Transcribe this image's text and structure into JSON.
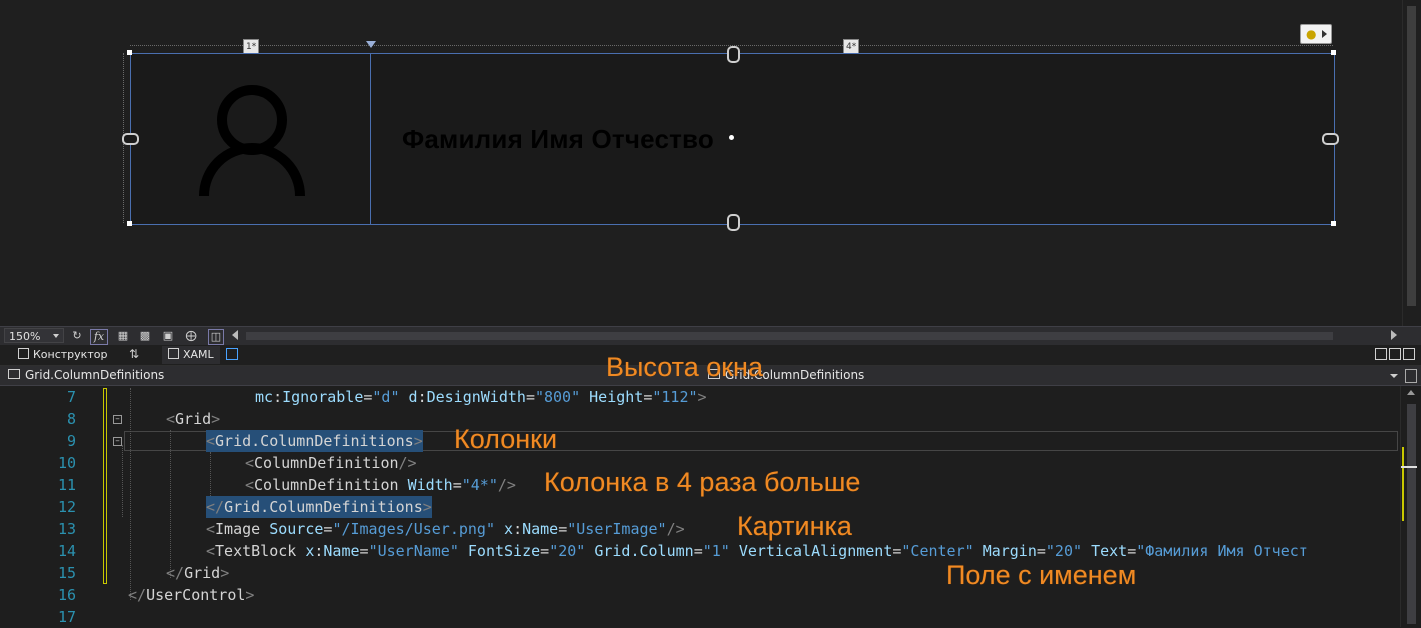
{
  "designer": {
    "column_tags": [
      "1*",
      "4*"
    ],
    "user_name_preview": "Фамилия Имя Отчество",
    "avatar_icon": "user-icon",
    "lightbulb_icon": "lightbulb-icon"
  },
  "toolbar": {
    "zoom": "150%",
    "icons": [
      "refresh-icon",
      "fx-icon",
      "grid-icon",
      "snap-grid-icon",
      "artboard-icon",
      "snap-lines-icon",
      "device-icon"
    ]
  },
  "tabs": {
    "designer": "Конструктор",
    "xaml": "XAML"
  },
  "nav": {
    "left": "Grid.ColumnDefinitions",
    "right": "Grid.ColumnDefinitions"
  },
  "code": {
    "lines": [
      {
        "n": "7"
      },
      {
        "n": "8"
      },
      {
        "n": "9"
      },
      {
        "n": "10"
      },
      {
        "n": "11"
      },
      {
        "n": "12"
      },
      {
        "n": "13"
      },
      {
        "n": "14"
      },
      {
        "n": "15"
      },
      {
        "n": "16"
      },
      {
        "n": "17"
      }
    ],
    "l7": {
      "mc": "mc",
      "ignorable": "Ignorable",
      "ignorable_val": "\"d\"",
      "d": "d",
      "dw": "DesignWidth",
      "dw_val": "\"800\"",
      "height": "Height",
      "height_val": "\"112\""
    },
    "l8": {
      "el": "Grid"
    },
    "l9": {
      "el": "Grid.ColumnDefinitions"
    },
    "l10": {
      "el": "ColumnDefinition"
    },
    "l11": {
      "el": "ColumnDefinition",
      "attr": "Width",
      "val": "\"4*\""
    },
    "l12": {
      "el": "Grid.ColumnDefinitions"
    },
    "l13": {
      "el": "Image",
      "a1": "Source",
      "v1": "\"/Images/User.png\"",
      "x": "x",
      "a2": "Name",
      "v2": "\"UserImage\""
    },
    "l14": {
      "el": "TextBlock",
      "x": "x",
      "a1": "Name",
      "v1": "\"UserName\"",
      "a2": "FontSize",
      "v2": "\"20\"",
      "a3": "Grid.Column",
      "v3": "\"1\"",
      "a4": "VerticalAlignment",
      "v4": "\"Center\"",
      "a5": "Margin",
      "v5": "\"20\"",
      "a6": "Text",
      "v6": "\"Фамилия Имя Отчест"
    },
    "l15": {
      "el": "Grid"
    },
    "l16": {
      "el": "UserControl"
    }
  },
  "annotations": {
    "window_height": "Высота окна",
    "columns": "Колонки",
    "column_4x": "Колонка в 4 раза больше",
    "picture": "Картинка",
    "name_field": "Поле с именем"
  },
  "colors": {
    "annotation": "#f08a24",
    "selection": "#264f78",
    "attribute": "#9cdcfe",
    "string": "#569cd6"
  }
}
